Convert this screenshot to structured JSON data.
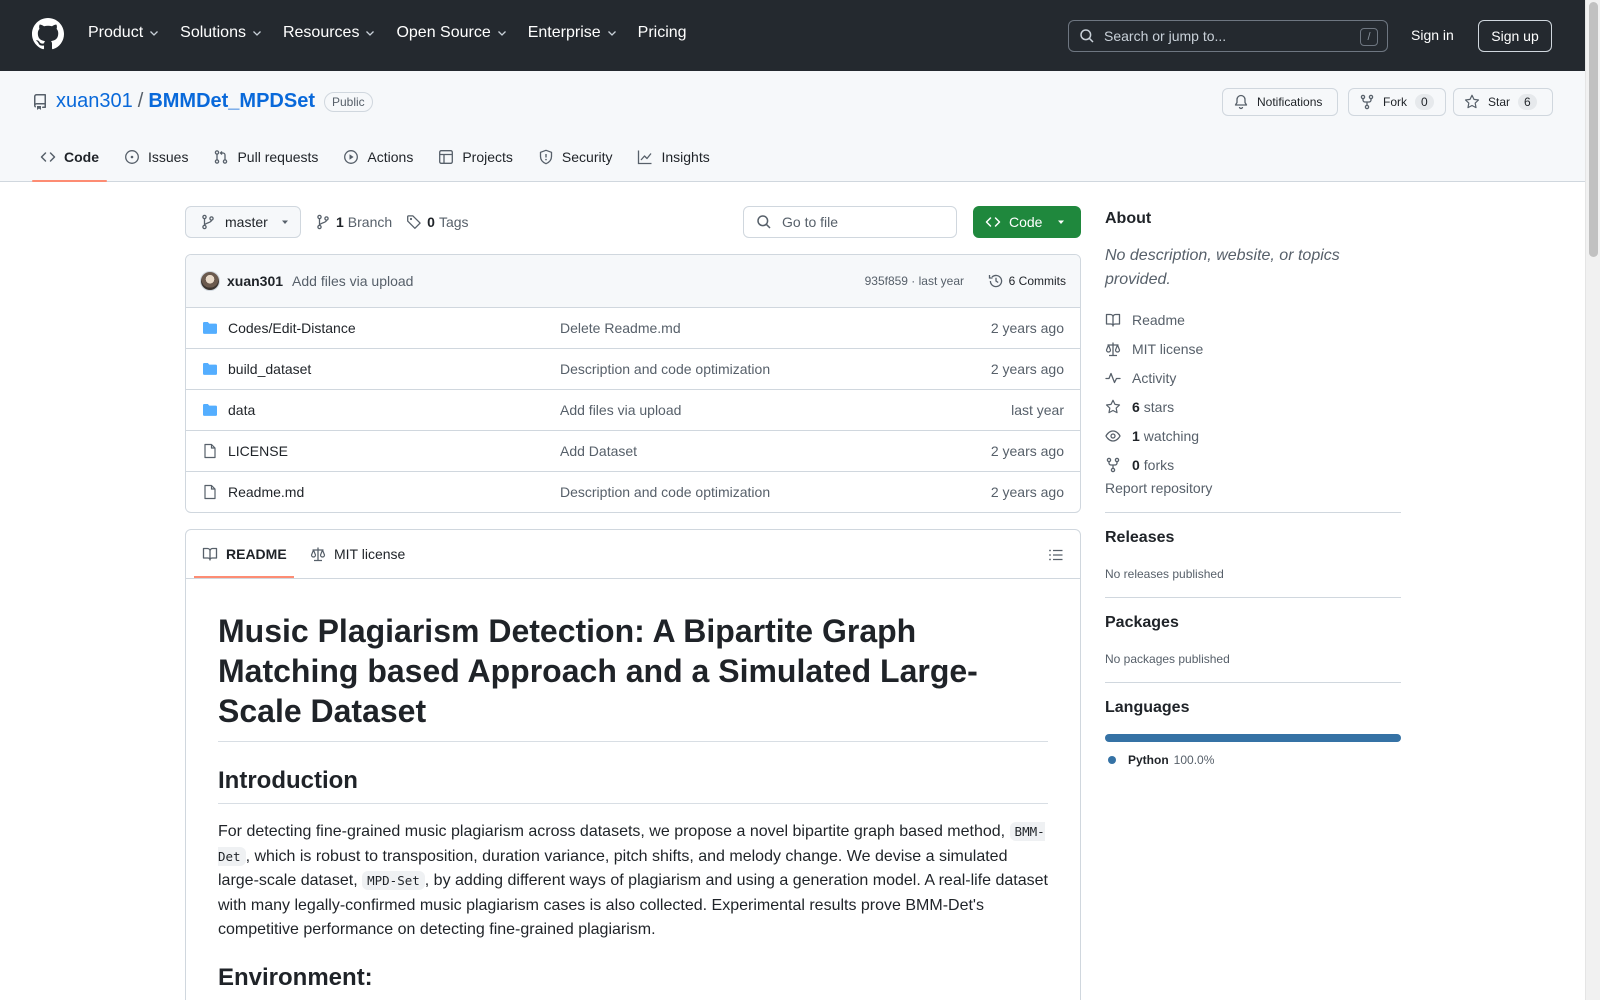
{
  "header": {
    "nav": [
      "Product",
      "Solutions",
      "Resources",
      "Open Source",
      "Enterprise",
      "Pricing"
    ],
    "search_placeholder": "Search or jump to...",
    "search_key": "/",
    "sign_in": "Sign in",
    "sign_up": "Sign up"
  },
  "repo": {
    "owner": "xuan301",
    "separator": "/",
    "name": "BMMDet_MPDSet",
    "visibility": "Public",
    "notifications_label": "Notifications",
    "fork_label": "Fork",
    "fork_count": "0",
    "star_label": "Star",
    "star_count": "6",
    "tabs": [
      "Code",
      "Issues",
      "Pull requests",
      "Actions",
      "Projects",
      "Security",
      "Insights"
    ]
  },
  "toolbar": {
    "branch": "master",
    "branch_count": "1",
    "branch_label": "Branch",
    "tag_count": "0",
    "tag_label": "Tags",
    "goto_placeholder": "Go to file",
    "code_label": "Code"
  },
  "commit": {
    "author": "xuan301",
    "message": "Add files via upload",
    "meta": "935f859 · last year",
    "commits": "6 Commits"
  },
  "files": [
    {
      "name": "Codes/Edit-Distance",
      "type": "folder",
      "message": "Delete Readme.md",
      "date": "2 years ago"
    },
    {
      "name": "build_dataset",
      "type": "folder",
      "message": "Description and code optimization",
      "date": "2 years ago"
    },
    {
      "name": "data",
      "type": "folder",
      "message": "Add files via upload",
      "date": "last year"
    },
    {
      "name": "LICENSE",
      "type": "file",
      "message": "Add Dataset",
      "date": "2 years ago"
    },
    {
      "name": "Readme.md",
      "type": "file",
      "message": "Description and code optimization",
      "date": "2 years ago"
    }
  ],
  "readme": {
    "tab_readme": "README",
    "tab_license": "MIT license",
    "title": "Music Plagiarism Detection: A Bipartite Graph Matching based Approach and a Simulated Large-Scale Dataset",
    "intro_heading": "Introduction",
    "intro_p1": "For detecting fine-grained music plagiarism across datasets, we propose a novel bipartite graph based method,",
    "intro_code1": "BMM-Det",
    "intro_p2": ", which is robust to transposition, duration variance, pitch shifts, and melody change. We devise a simulated large-scale dataset,",
    "intro_code2": "MPD-Set",
    "intro_p3": ", by adding different ways of plagiarism and using a generation model. A real-life dataset with many legally-confirmed music plagiarism cases is also collected. Experimental results prove BMM-Det's competitive performance on detecting fine-grained plagiarism.",
    "env_heading": "Environment:"
  },
  "sidebar": {
    "about_title": "About",
    "about_desc": "No description, website, or topics provided.",
    "readme": "Readme",
    "license": "MIT license",
    "activity": "Activity",
    "stars_count": "6",
    "stars_label": "stars",
    "watching_count": "1",
    "watching_label": "watching",
    "forks_count": "0",
    "forks_label": "forks",
    "report": "Report repository",
    "releases_title": "Releases",
    "releases_note": "No releases published",
    "packages_title": "Packages",
    "packages_note": "No packages published",
    "languages_title": "Languages",
    "language_name": "Python",
    "language_pct": "100.0%",
    "language_share": 1.0,
    "language_color": "#3572a5"
  },
  "colors": {
    "header_bg": "#24292f",
    "link": "#0969da",
    "code_button": "#1f883d",
    "tab_underline": "#fd8c73"
  }
}
